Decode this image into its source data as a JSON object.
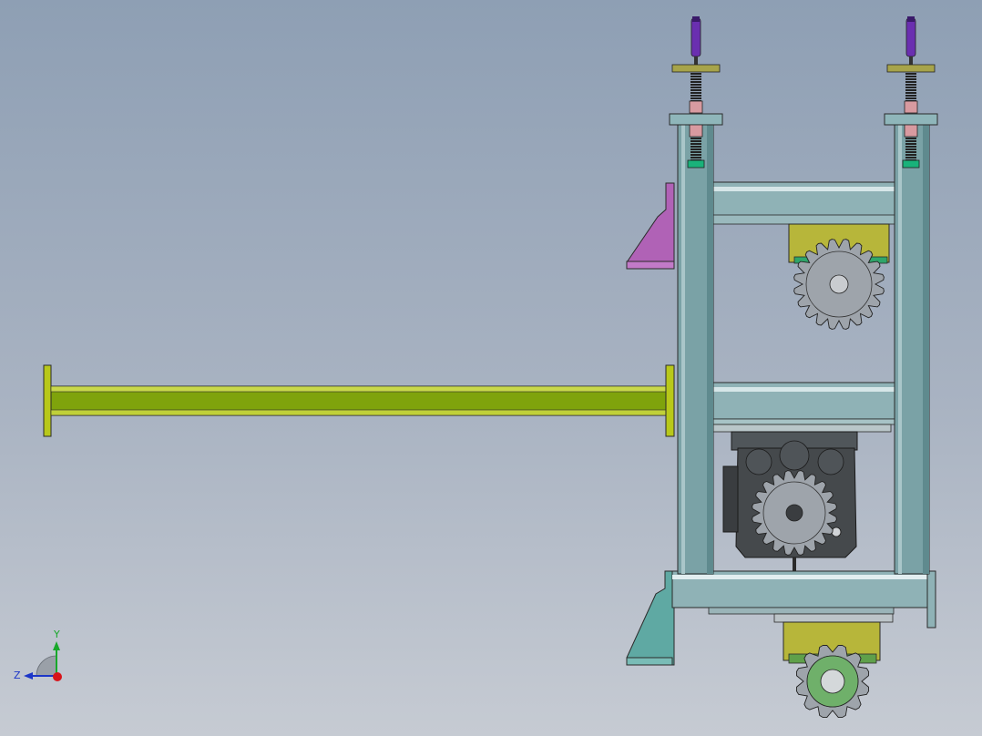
{
  "triad": {
    "y_label": "Y",
    "z_label": "Z",
    "x_color": "#d8141a",
    "y_color": "#18a82a",
    "z_color": "#1c36c8"
  },
  "colors": {
    "frame_teal": "#7aa2a6",
    "frame_dark": "#3f5a5e",
    "beam_light": "#b8d0d3",
    "boom_yellow_green": "#8fb00e",
    "bracket_magenta": "#b062b6",
    "bracket_teal": "#5fa9a3",
    "motor_yellow": "#b7b63a",
    "gearbox_dark": "#45494c",
    "sprocket_gray": "#9ea4ab",
    "sprocket_green": "#6fb06a",
    "handle_purple": "#6a2fb0",
    "nut_pink": "#d89aa0",
    "nut_green": "#19b27a",
    "plate_khaki": "#a7a44a"
  }
}
